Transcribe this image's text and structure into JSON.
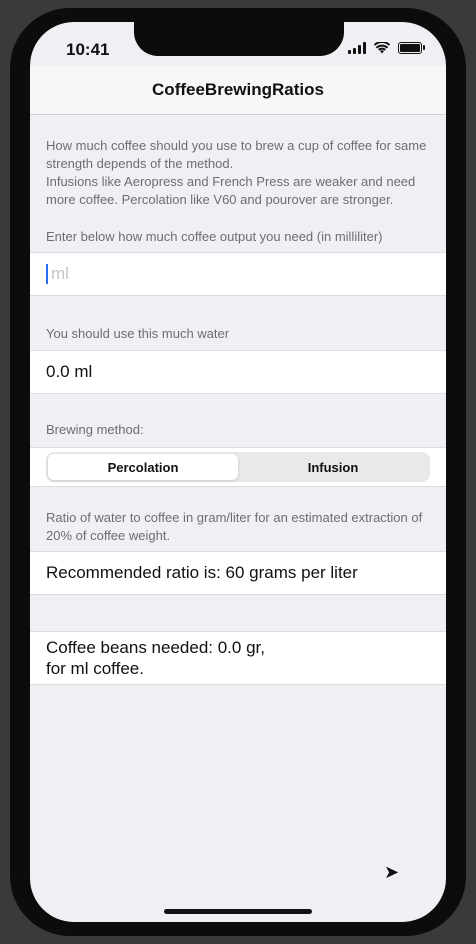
{
  "status": {
    "time": "10:41"
  },
  "navbar": {
    "title": "CoffeeBrewingRatios"
  },
  "intro": {
    "line1": "How much coffee should you use to brew a cup of coffee for same strength depends of the method.",
    "line2": "Infusions like Aeropress and French Press are weaker and need more coffee. Percolation like V60 and pourover are stronger."
  },
  "coffee_output": {
    "label": "Enter below how much coffee output you need (in milliliter)",
    "value": "",
    "placeholder": "ml"
  },
  "water": {
    "label": "You should use this much water",
    "value": "0.0 ml"
  },
  "brewing_method": {
    "label": "Brewing method:",
    "options": [
      "Percolation",
      "Infusion"
    ],
    "selected": "Percolation"
  },
  "ratio": {
    "label": "Ratio of water to coffee in gram/liter for an estimated extraction of 20% of coffee weight.",
    "value": "Recommended ratio is: 60 grams per liter"
  },
  "result": {
    "line1": "Coffee beans needed: 0.0 gr,",
    "line2": "for  ml coffee."
  }
}
